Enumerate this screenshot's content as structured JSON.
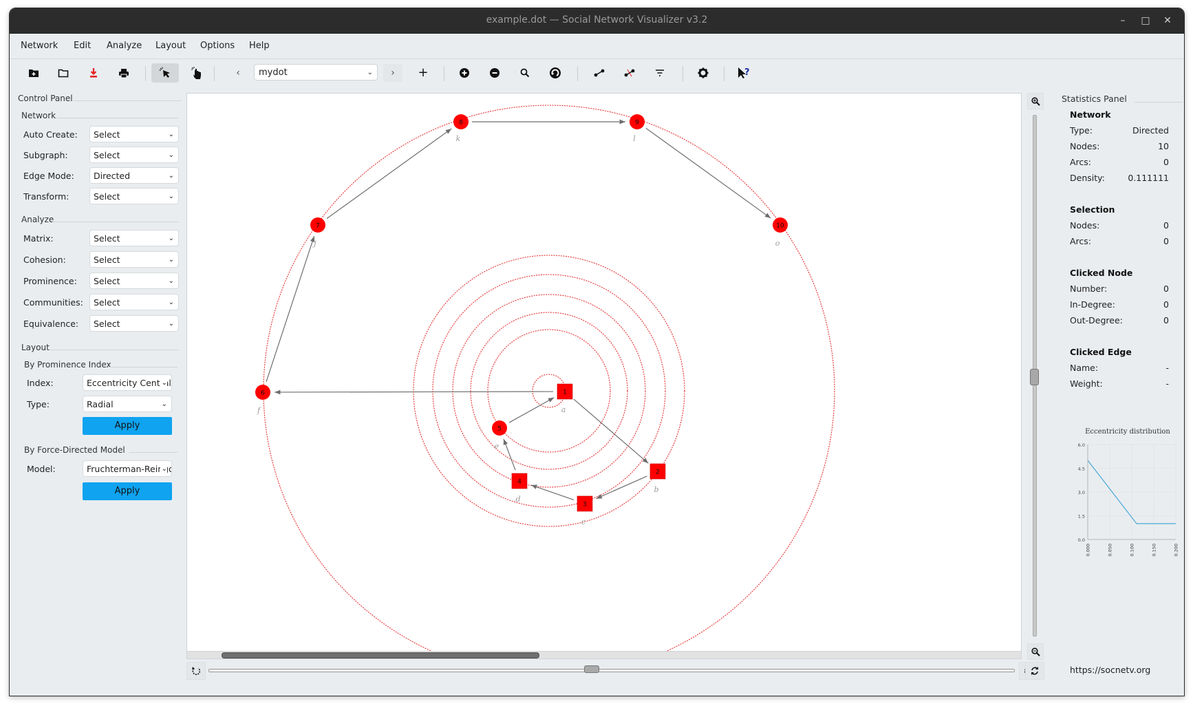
{
  "window": {
    "title": "example.dot — Social Network Visualizer v3.2",
    "controls": {
      "minimize": "–",
      "maximize": "□",
      "close": "✕"
    }
  },
  "menubar": [
    {
      "label": "Network"
    },
    {
      "label": "Edit"
    },
    {
      "label": "Analyze"
    },
    {
      "label": "Layout"
    },
    {
      "label": "Options"
    },
    {
      "label": "Help"
    }
  ],
  "toolbar": {
    "icons": [
      "new-network-icon",
      "open-folder-icon",
      "save-icon",
      "print-icon",
      "select-cursor-icon",
      "pan-hand-icon",
      "previous-icon",
      "next-icon",
      "add-node-icon",
      "zoom-in-icon",
      "zoom-out-icon",
      "find-node-icon",
      "rotate-icon",
      "add-edge-icon",
      "remove-edge-icon",
      "filter-icon",
      "settings-icon",
      "whats-this-icon"
    ],
    "network_combo": "mydot",
    "prev": "‹",
    "next": "›",
    "add": "+"
  },
  "control_panel": {
    "title": "Control Panel",
    "network": {
      "title": "Network",
      "rows": [
        {
          "label": "Auto Create:",
          "value": "Select"
        },
        {
          "label": "Subgraph:",
          "value": "Select"
        },
        {
          "label": "Edge Mode:",
          "value": "Directed"
        },
        {
          "label": "Transform:",
          "value": "Select"
        }
      ]
    },
    "analyze": {
      "title": "Analyze",
      "rows": [
        {
          "label": "Matrix:",
          "value": "Select"
        },
        {
          "label": "Cohesion:",
          "value": "Select"
        },
        {
          "label": "Prominence:",
          "value": "Select"
        },
        {
          "label": "Communities:",
          "value": "Select"
        },
        {
          "label": "Equivalence:",
          "value": "Select"
        }
      ]
    },
    "layout": {
      "title": "Layout",
      "prominence": {
        "title": "By Prominence Index",
        "index_label": "Index:",
        "index_value": "Eccentricity Centrality",
        "type_label": "Type:",
        "type_value": "Radial",
        "apply": "Apply"
      },
      "force": {
        "title": "By Force-Directed Model",
        "model_label": "Model:",
        "model_value": "Fruchterman-Reingold",
        "apply": "Apply"
      }
    }
  },
  "graph": {
    "node_color": "#ff0000",
    "edge_color": "#6e6e6e",
    "guide_color": "#e53030",
    "nodes": [
      {
        "id": "1",
        "label": "a",
        "shape": "box"
      },
      {
        "id": "2",
        "label": "b",
        "shape": "box"
      },
      {
        "id": "3",
        "label": "c",
        "shape": "box"
      },
      {
        "id": "4",
        "label": "d",
        "shape": "box"
      },
      {
        "id": "5",
        "label": "e",
        "shape": "circle"
      },
      {
        "id": "6",
        "label": "f",
        "shape": "circle"
      },
      {
        "id": "7",
        "label": "j",
        "shape": "circle"
      },
      {
        "id": "8",
        "label": "k",
        "shape": "circle"
      },
      {
        "id": "9",
        "label": "l",
        "shape": "circle"
      },
      {
        "id": "10",
        "label": "o",
        "shape": "circle"
      }
    ],
    "edges": [
      {
        "from": "1",
        "to": "2"
      },
      {
        "from": "2",
        "to": "3"
      },
      {
        "from": "3",
        "to": "4"
      },
      {
        "from": "4",
        "to": "5"
      },
      {
        "from": "5",
        "to": "1"
      },
      {
        "from": "1",
        "to": "6"
      },
      {
        "from": "6",
        "to": "7"
      },
      {
        "from": "7",
        "to": "8"
      },
      {
        "from": "8",
        "to": "9"
      },
      {
        "from": "9",
        "to": "10"
      }
    ]
  },
  "statistics": {
    "title": "Statistics Panel",
    "network": {
      "title": "Network",
      "rows": [
        {
          "k": "Type:",
          "v": "Directed"
        },
        {
          "k": "Nodes:",
          "v": "10"
        },
        {
          "k": "Arcs:",
          "v": "0"
        },
        {
          "k": "Density:",
          "v": "0.111111"
        }
      ]
    },
    "selection": {
      "title": "Selection",
      "rows": [
        {
          "k": "Nodes:",
          "v": "0"
        },
        {
          "k": "Arcs:",
          "v": "0"
        }
      ]
    },
    "clicked_node": {
      "title": "Clicked Node",
      "rows": [
        {
          "k": "Number:",
          "v": "0"
        },
        {
          "k": "In-Degree:",
          "v": "0"
        },
        {
          "k": "Out-Degree:",
          "v": "0"
        }
      ]
    },
    "clicked_edge": {
      "title": "Clicked Edge",
      "rows": [
        {
          "k": "Name:",
          "v": "-"
        },
        {
          "k": "Weight:",
          "v": "-"
        }
      ]
    },
    "url": "https://socnetv.org"
  },
  "chart_data": {
    "type": "line",
    "title": "Eccentricity distribution",
    "x": [
      0.0,
      0.111,
      0.2
    ],
    "series": [
      {
        "name": "Eccentricity",
        "values": [
          5.0,
          1.0,
          1.0
        ]
      }
    ],
    "xticks": [
      "0.000",
      "0.050",
      "0.100",
      "0.150",
      "0.200"
    ],
    "yticks": [
      "0.0",
      "1.5",
      "3.0",
      "4.5",
      "6.0"
    ],
    "xlim": [
      0,
      0.2
    ],
    "ylim": [
      0,
      6
    ],
    "grid": true,
    "line_color": "#4aa8d8"
  }
}
